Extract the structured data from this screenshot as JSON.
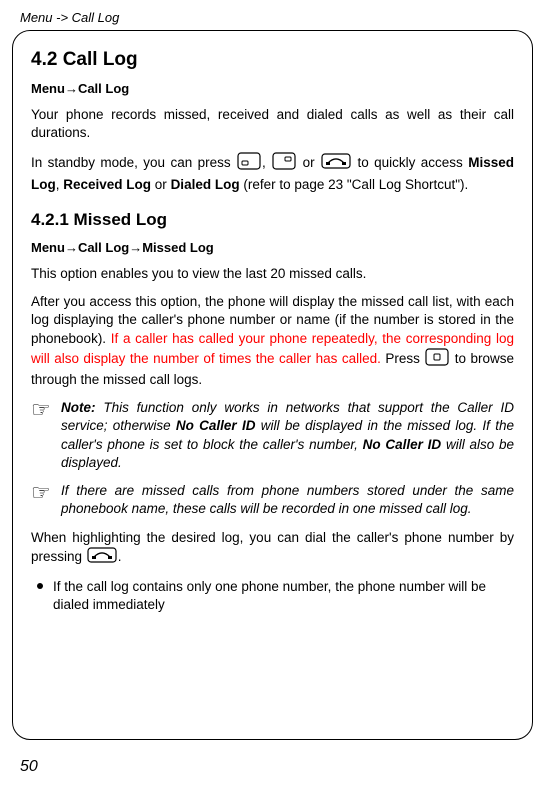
{
  "header": {
    "breadcrumb": "Menu -> Call Log"
  },
  "sections": {
    "s42": {
      "title": "4.2 Call Log",
      "menuPath": "Menu→Call Log",
      "intro": "Your phone records missed, received and dialed calls as well as their call durations.",
      "standby_before": "In standby mode, you can press ",
      "standby_mid1": ", ",
      "standby_mid2": " or ",
      "standby_after": " to quickly access ",
      "missedLog": "Missed Log",
      "receivedLog": "Received Log",
      "dialedLog": "Dialed Log",
      "standby_tail": " (refer to page 23 \"Call Log Shortcut\").",
      "or": " or "
    },
    "s421": {
      "title": "4.2.1 Missed Log",
      "menuPath": "Menu→Call Log→Missed Log",
      "intro": "This option enables you to view the last 20 missed calls.",
      "para2_part1": "After you access this option, the phone will display the missed call list, with each log displaying the caller's phone number or name (if the number is stored in the phonebook). ",
      "para2_red": "If a caller has called your phone repeatedly, the corresponding log will also display the number of times the caller has called.",
      "para2_part2a": " Press ",
      "para2_part2b": " to browse through the missed call logs.",
      "note1_label": "Note:",
      "note1_text1": " This function only works in networks that support the Caller ID service; otherwise ",
      "note1_bold1": "No Caller ID",
      "note1_text2": " will be displayed in the missed log. If the caller's phone is set to block the caller's number, ",
      "note1_bold2": "No Caller ID",
      "note1_text3": " will also be displayed.",
      "note2": "If there are missed calls from phone numbers stored under the same phonebook name, these calls will be recorded in one missed call log.",
      "highlight_before": "When highlighting the desired log, you can dial the caller's phone number by pressing ",
      "highlight_after": ".",
      "bullet1": "If the call log contains only one phone number, the phone number will be dialed immediately"
    }
  },
  "pageNumber": "50"
}
